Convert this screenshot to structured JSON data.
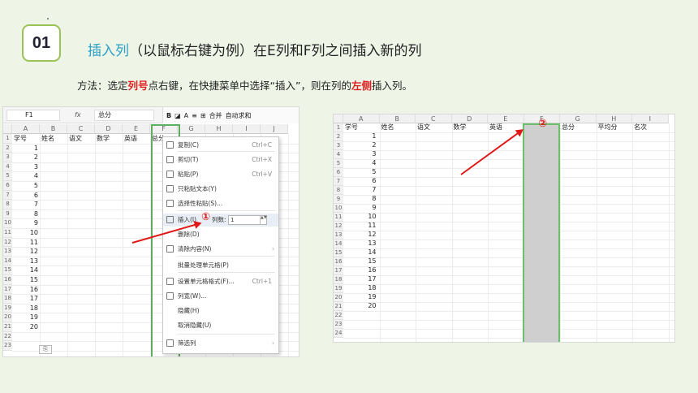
{
  "badge": "01",
  "heading": {
    "accent": "插入列",
    "rest": "（以鼠标右键为例）在E列和F列之间插入新的列"
  },
  "method": {
    "p1": "方法：选定",
    "b1": "列号",
    "p2": "点右键，在快捷菜单中选择“插入”，则在列的",
    "b2": "左侧",
    "p3": "插入列。"
  },
  "step_marks": [
    "①",
    "②"
  ],
  "left_sheet": {
    "name_box": "F1",
    "fx_label": "fx",
    "formula_value": "总分",
    "ribbon": {
      "bold": "B",
      "merge": "合并",
      "autosum": "自动求和"
    },
    "columns": [
      "A",
      "B",
      "C",
      "D",
      "E",
      "F",
      "G",
      "H",
      "I",
      "J"
    ],
    "row_numbers": [
      "1",
      "2",
      "3",
      "4",
      "5",
      "6",
      "7",
      "8",
      "9",
      "10",
      "11",
      "12",
      "13",
      "14",
      "15",
      "16",
      "17",
      "18",
      "19",
      "20",
      "21",
      "22",
      "23"
    ],
    "headers": [
      "学号",
      "姓名",
      "语文",
      "数学",
      "英语",
      "总分"
    ],
    "ids": [
      "1",
      "2",
      "3",
      "4",
      "5",
      "6",
      "7",
      "8",
      "9",
      "10",
      "11",
      "12",
      "13",
      "14",
      "15",
      "16",
      "17",
      "18",
      "19",
      "20"
    ]
  },
  "context_menu": {
    "items": [
      {
        "label": "复制(C)",
        "shortcut": "Ctrl+C"
      },
      {
        "label": "剪切(T)",
        "shortcut": "Ctrl+X"
      },
      {
        "label": "粘贴(P)",
        "shortcut": "Ctrl+V"
      },
      {
        "label": "只粘贴文本(Y)",
        "shortcut": ""
      },
      {
        "label": "选择性粘贴(S)...",
        "shortcut": ""
      },
      {
        "label": "插入(I)",
        "shortcut": ""
      },
      {
        "label": "删除(D)",
        "shortcut": ""
      },
      {
        "label": "清除内容(N)",
        "shortcut": ""
      },
      {
        "label": "批量处理单元格(P)",
        "shortcut": ""
      },
      {
        "label": "设置单元格格式(F)...",
        "shortcut": "Ctrl+1"
      },
      {
        "label": "列宽(W)...",
        "shortcut": ""
      },
      {
        "label": "隐藏(H)",
        "shortcut": ""
      },
      {
        "label": "取消隐藏(U)",
        "shortcut": ""
      },
      {
        "label": "筛选列",
        "shortcut": ""
      }
    ],
    "insert_cols_label": "列数:",
    "insert_cols_value": "1"
  },
  "right_sheet": {
    "columns": [
      "A",
      "B",
      "C",
      "D",
      "E",
      "F",
      "G",
      "H",
      "I"
    ],
    "row_numbers": [
      "1",
      "2",
      "3",
      "4",
      "5",
      "6",
      "7",
      "8",
      "9",
      "10",
      "11",
      "12",
      "13",
      "14",
      "15",
      "16",
      "17",
      "18",
      "19",
      "20",
      "21",
      "22",
      "23",
      "24"
    ],
    "headers": [
      "学号",
      "姓名",
      "语文",
      "数学",
      "英语",
      "",
      "总分",
      "平均分",
      "名次"
    ],
    "ids": [
      "1",
      "2",
      "3",
      "4",
      "5",
      "6",
      "7",
      "8",
      "9",
      "10",
      "11",
      "12",
      "13",
      "14",
      "15",
      "16",
      "17",
      "18",
      "19",
      "20"
    ]
  },
  "colors": {
    "accent_blue": "#2aa0c8",
    "highlight_red": "#e02020",
    "selection_green": "#5fae5f",
    "badge_border": "#9bc255"
  }
}
